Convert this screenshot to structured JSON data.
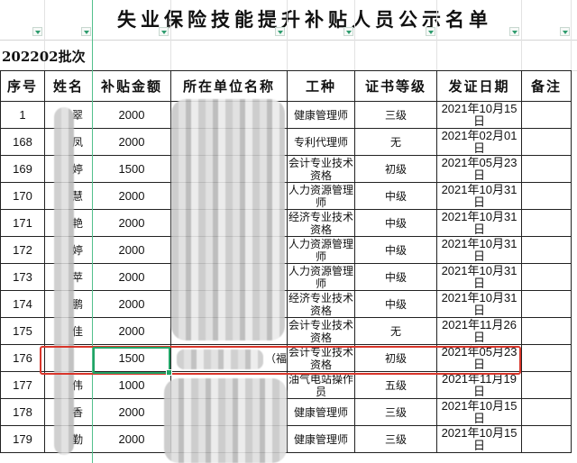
{
  "title": "失业保险技能提升补贴人员公示名单",
  "batch": "202202批次",
  "headers": [
    "序号",
    "姓名",
    "补贴金额",
    "所在单位名称",
    "工种",
    "证书等级",
    "发证日期",
    "备注"
  ],
  "rows": [
    {
      "id": "1",
      "name": "翠",
      "amount": "2000",
      "unit": "",
      "job": "健康管理师",
      "level": "三级",
      "date": "2021年10月15日",
      "note": ""
    },
    {
      "id": "168",
      "name": "凤",
      "amount": "2000",
      "unit": "",
      "job": "专利代理师",
      "level": "无",
      "date": "2021年02月01日",
      "note": ""
    },
    {
      "id": "169",
      "name": "婷",
      "amount": "1500",
      "unit": "",
      "job": "会计专业技术资格",
      "level": "初级",
      "date": "2021年05月23日",
      "note": ""
    },
    {
      "id": "170",
      "name": "慧",
      "amount": "2000",
      "unit": "",
      "job": "人力资源管理师",
      "level": "中级",
      "date": "2021年10月31日",
      "note": ""
    },
    {
      "id": "171",
      "name": "艳",
      "amount": "2000",
      "unit": "",
      "job": "经济专业技术资格",
      "level": "中级",
      "date": "2021年10月31日",
      "note": ""
    },
    {
      "id": "172",
      "name": "婷",
      "amount": "2000",
      "unit": "",
      "job": "人力资源管理师",
      "level": "中级",
      "date": "2021年10月31日",
      "note": ""
    },
    {
      "id": "173",
      "name": "苹",
      "amount": "2000",
      "unit": "",
      "job": "人力资源管理师",
      "level": "中级",
      "date": "2021年10月31日",
      "note": ""
    },
    {
      "id": "174",
      "name": "鹏",
      "amount": "2000",
      "unit": "",
      "job": "经济专业技术资格",
      "level": "中级",
      "date": "2021年10月31日",
      "note": ""
    },
    {
      "id": "175",
      "name": "佳",
      "amount": "2000",
      "unit": "",
      "job": "会计专业技术资格",
      "level": "无",
      "date": "2021年11月26日",
      "note": ""
    },
    {
      "id": "176",
      "name": "",
      "amount": "1500",
      "unit": "（福",
      "job": "会计专业技术资格",
      "level": "初级",
      "date": "2021年05月23日",
      "note": ""
    },
    {
      "id": "177",
      "name": "伟",
      "amount": "1000",
      "unit": "",
      "job": "油气电站操作员",
      "level": "五级",
      "date": "2021年11月19日",
      "note": ""
    },
    {
      "id": "178",
      "name": "香",
      "amount": "2000",
      "unit": "",
      "job": "健康管理师",
      "level": "三级",
      "date": "2021年10月15日",
      "note": ""
    },
    {
      "id": "179",
      "name": "勤",
      "amount": "2000",
      "unit": "",
      "job": "健康管理师",
      "level": "三级",
      "date": "2021年10月15日",
      "note": ""
    }
  ],
  "highlight": {
    "row_id": "176",
    "color": "#d9362b"
  },
  "active_cell": {
    "row_id": "176",
    "column": "补贴金额",
    "color": "#21a366"
  }
}
